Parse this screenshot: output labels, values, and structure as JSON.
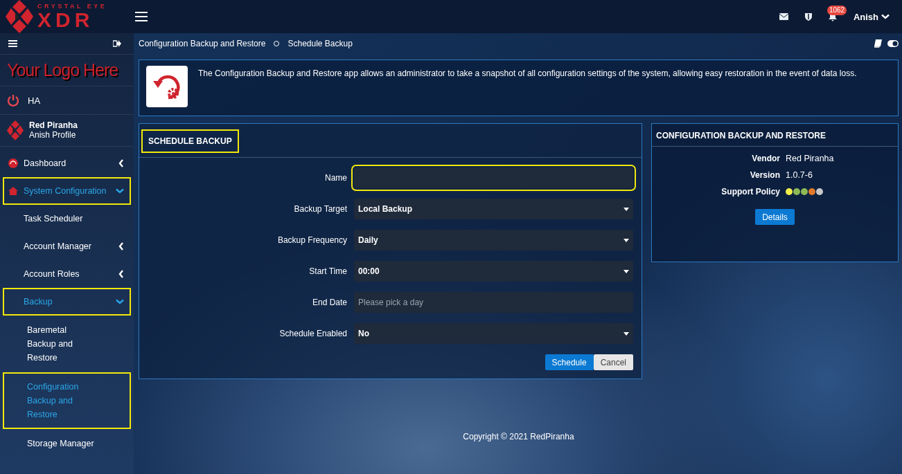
{
  "brand": {
    "top": "CRYSTAL EYE",
    "main": "XDR"
  },
  "header": {
    "notifications": "1062",
    "user": "Anish"
  },
  "sidebar": {
    "logo_text": "Your Logo Here",
    "ha": "HA",
    "profile": {
      "name": "Red Piranha",
      "sub": "Anish Profile"
    },
    "items": [
      {
        "label": "Dashboard",
        "selected": false,
        "highlighted": false,
        "has_submenu": true,
        "expanded": false
      },
      {
        "label": "System Configuration",
        "selected": true,
        "highlighted": true,
        "has_submenu": true,
        "expanded": true,
        "children": [
          {
            "label": "Task Scheduler",
            "selected": false,
            "highlighted": false,
            "has_submenu": false,
            "expanded": false
          },
          {
            "label": "Account Manager",
            "selected": false,
            "highlighted": false,
            "has_submenu": true,
            "expanded": false
          },
          {
            "label": "Account Roles",
            "selected": false,
            "highlighted": false,
            "has_submenu": true,
            "expanded": false
          },
          {
            "label": "Backup",
            "selected": true,
            "highlighted": true,
            "has_submenu": true,
            "expanded": true,
            "children": [
              {
                "label": "Baremetal Backup and Restore",
                "selected": false,
                "highlighted": false
              },
              {
                "label": "Configuration Backup and Restore",
                "selected": true,
                "highlighted": true
              },
              {
                "label": "Storage Manager",
                "selected": false,
                "highlighted": false
              }
            ]
          }
        ]
      }
    ]
  },
  "breadcrumb": [
    "Configuration Backup and Restore",
    "Schedule Backup"
  ],
  "intro": "The Configuration Backup and Restore app allows an administrator to take a snapshot of all configuration settings of the system, allowing easy restoration in the event of data loss.",
  "form": {
    "title": "SCHEDULE BACKUP",
    "title_highlighted": true,
    "fields": [
      {
        "label": "Name",
        "kind": "text",
        "highlighted": true
      },
      {
        "label": "Backup Target",
        "kind": "select",
        "value": "Local Backup",
        "highlighted": false
      },
      {
        "label": "Backup Frequency",
        "kind": "select",
        "value": "Daily",
        "highlighted": false
      },
      {
        "label": "Start Time",
        "kind": "select",
        "value": "00:00",
        "highlighted": false
      },
      {
        "label": "End Date",
        "kind": "text",
        "placeholder": "Please pick a day",
        "highlighted": false
      },
      {
        "label": "Schedule Enabled",
        "kind": "select",
        "value": "No",
        "highlighted": false
      }
    ],
    "buttons": [
      {
        "label": "Schedule",
        "kind": "primary"
      },
      {
        "label": "Cancel",
        "kind": "secondary"
      }
    ]
  },
  "app_info": {
    "title": "CONFIGURATION BACKUP AND RESTORE",
    "rows": [
      {
        "label": "Vendor",
        "value": "Red Piranha"
      },
      {
        "label": "Version",
        "value": "1.0.7-6"
      }
    ],
    "support_label": "Support Policy",
    "support_dots": [
      {
        "color": "#f2ee4a"
      },
      {
        "color": "#8dba55"
      },
      {
        "color": "#8dba55"
      },
      {
        "color": "#e07a2a"
      },
      {
        "color": "#c8c8c8"
      }
    ],
    "button": "Details"
  },
  "footer": "Copyright © 2021 RedPiranha"
}
